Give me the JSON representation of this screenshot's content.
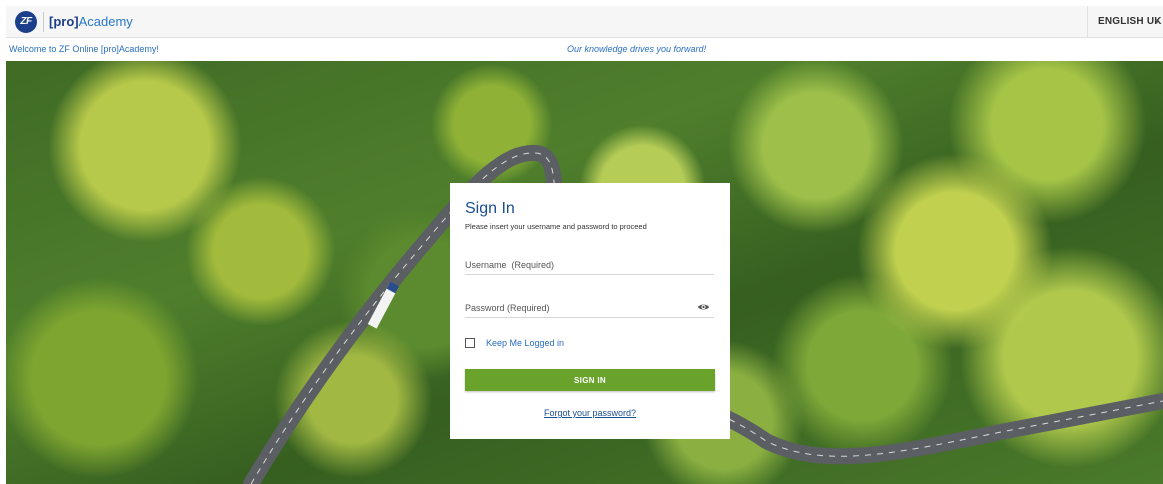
{
  "header": {
    "logo_text": "ZF",
    "brand_prefix": "[pro]",
    "brand_suffix": "Academy",
    "language": "ENGLISH UK",
    "language_caret": "▾"
  },
  "strip": {
    "welcome": "Welcome to ZF Online [pro]Academy!",
    "tagline": "Our knowledge drives you forward!"
  },
  "signin": {
    "title": "Sign In",
    "subtitle": "Please insert your username and password to proceed",
    "username_placeholder": "Username  (Required)",
    "password_placeholder": "Password (Required)",
    "keep_logged_in": "Keep Me Logged in",
    "button": "SIGN IN",
    "forgot": "Forgot your password?"
  },
  "colors": {
    "brand_blue": "#1b3f8b",
    "link_blue": "#2a6fbf",
    "button_green": "#6aa32c"
  }
}
